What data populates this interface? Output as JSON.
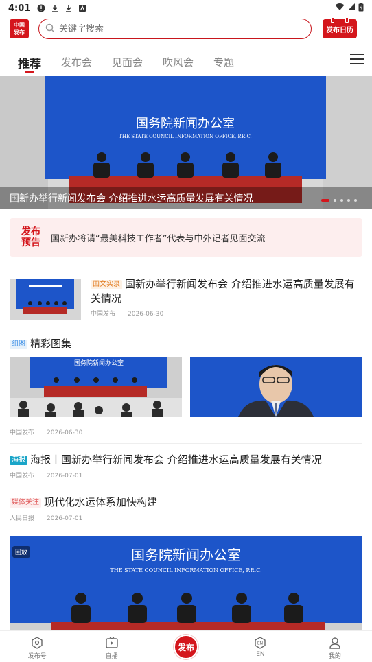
{
  "status_bar": {
    "time": "4:01"
  },
  "header": {
    "logo_line1": "中国",
    "logo_line2": "发布",
    "search_placeholder": "关键字搜索",
    "calendar_label": "发布日历"
  },
  "tabs": [
    {
      "label": "推荐",
      "active": true
    },
    {
      "label": "发布会"
    },
    {
      "label": "见面会"
    },
    {
      "label": "吹风会"
    },
    {
      "label": "专题"
    }
  ],
  "hero": {
    "backdrop_title": "国务院新闻办公室",
    "backdrop_subtitle": "THE STATE COUNCIL INFORMATION OFFICE, P.R.C.",
    "caption": "国新办举行新闻发布会 介绍推进水运高质量发展有关情况",
    "slides": 5,
    "active_slide": 0
  },
  "announcement": {
    "tag_line1": "发布",
    "tag_line2": "预告",
    "text": "国新办将请“最美科技工作者”代表与中外记者见面交流"
  },
  "article1": {
    "badge": "国文实录",
    "title": "国新办举行新闻发布会 介绍推进水运高质量发展有关情况",
    "source": "中国发布",
    "date": "2026-06-30"
  },
  "gallery": {
    "badge": "组图",
    "title": "精彩图集",
    "image_banner": "国务院新闻办公室",
    "image_subtitle": "THE STATE COUNCIL INFORMATION OFFICE, P.R.C.",
    "source": "中国发布",
    "date": "2026-06-30"
  },
  "article3": {
    "badge": "海报",
    "title": "海报丨国新办举行新闻发布会 介绍推进水运高质量发展有关情况",
    "source": "中国发布",
    "date": "2026-07-01"
  },
  "article4": {
    "badge": "媒体关注",
    "title": "现代化水运体系加快构建",
    "source": "人民日报",
    "date": "2026-07-01"
  },
  "video": {
    "badge": "回放",
    "backdrop_title": "国务院新闻办公室",
    "backdrop_subtitle": "THE STATE COUNCIL INFORMATION OFFICE, P.R.C."
  },
  "bottom_nav": [
    {
      "label": "发布号",
      "icon": "hexagon-icon"
    },
    {
      "label": "直播",
      "icon": "tv-icon"
    },
    {
      "label": "发布",
      "icon": "publish-icon"
    },
    {
      "label": "EN",
      "icon": "en-icon"
    },
    {
      "label": "我的",
      "icon": "person-icon"
    }
  ],
  "colors": {
    "brand_red": "#d4161c",
    "stage_blue": "#1d55c9"
  }
}
